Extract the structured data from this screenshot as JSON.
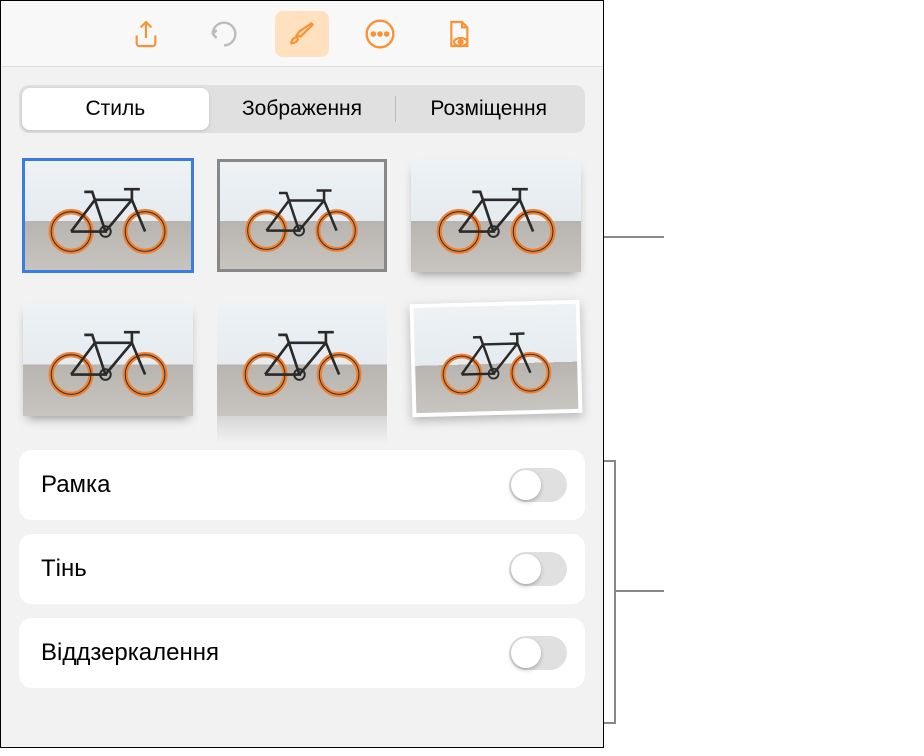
{
  "toolbar": {
    "share_icon": "share-icon",
    "undo_icon": "undo-icon",
    "format_icon": "paintbrush-icon",
    "more_icon": "more-icon",
    "document_icon": "document-view-icon"
  },
  "tabs": {
    "style": "Стиль",
    "image": "Зображення",
    "arrange": "Розміщення"
  },
  "options": {
    "border": "Рамка",
    "shadow": "Тінь",
    "reflection": "Віддзеркалення"
  },
  "colors": {
    "accent": "#f89234",
    "toggle_off": "#e0e0e0"
  }
}
